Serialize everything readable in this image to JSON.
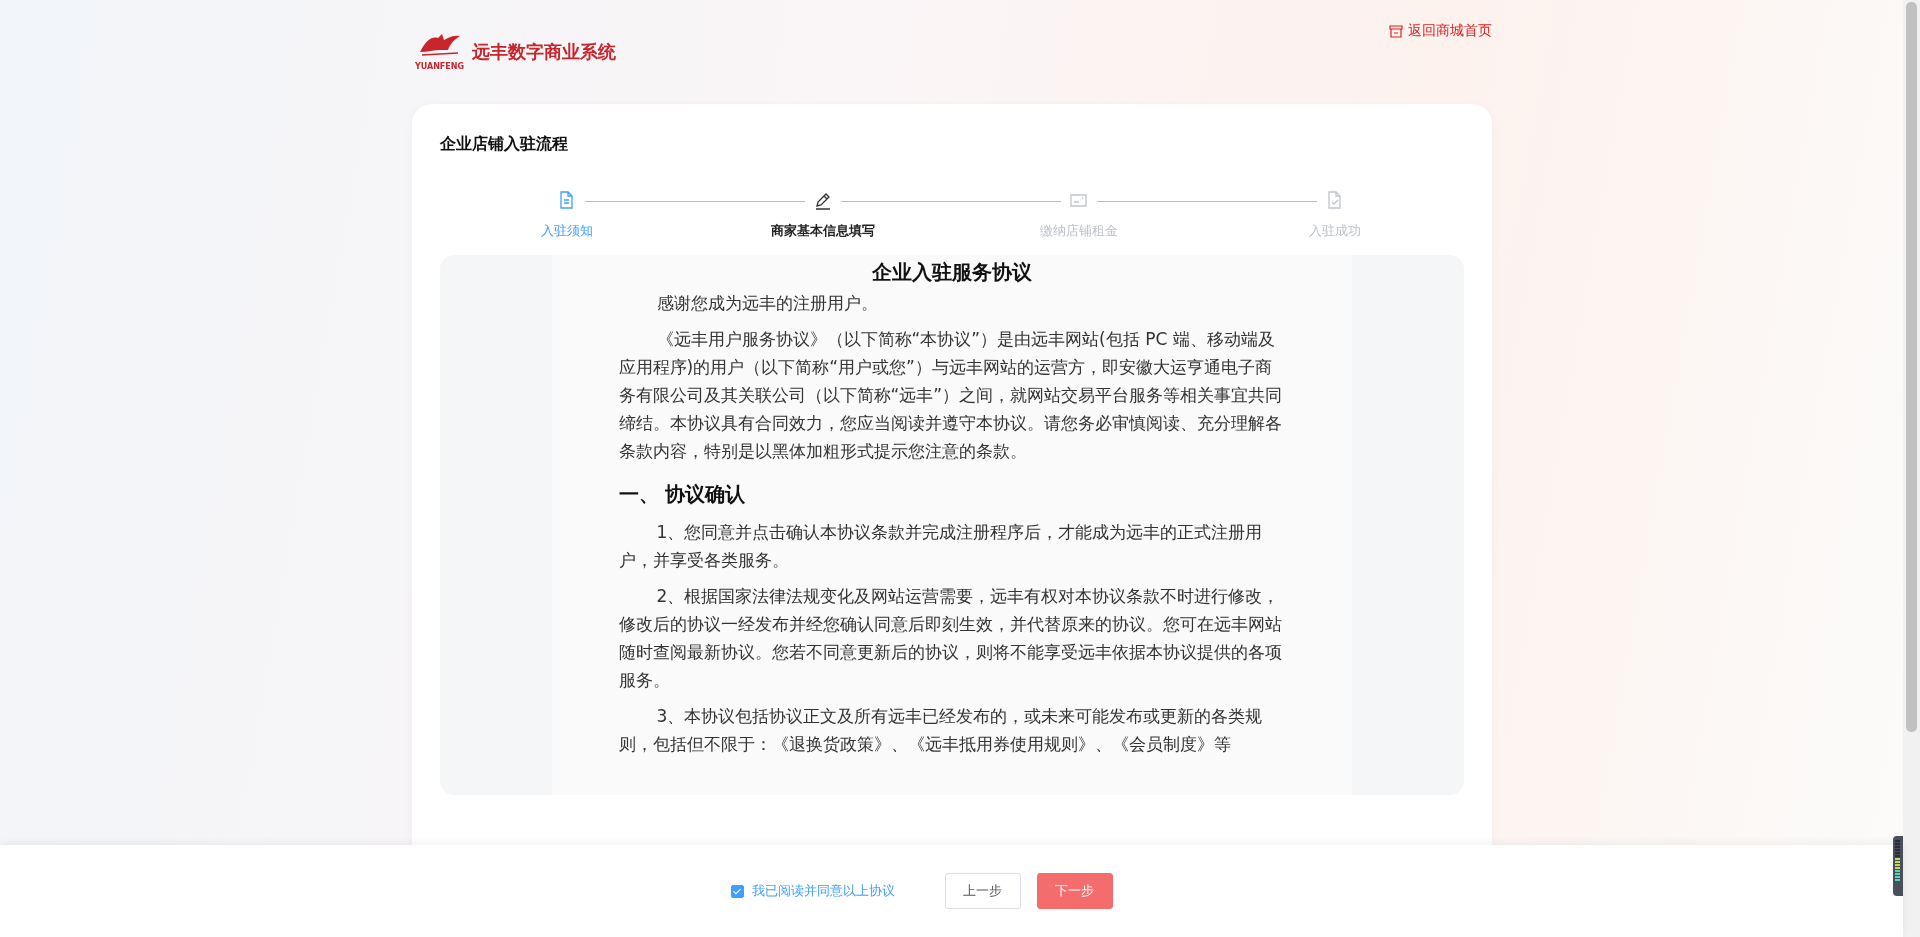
{
  "header": {
    "brand": "远丰数字商业系统",
    "logo_text": "YUANFENG",
    "home_link": "返回商城首页"
  },
  "card": {
    "title": "企业店铺入驻流程"
  },
  "steps": [
    {
      "label": "入驻须知",
      "kind": "done"
    },
    {
      "label": "商家基本信息填写",
      "kind": "current"
    },
    {
      "label": "缴纳店铺租金",
      "kind": "pending"
    },
    {
      "label": "入驻成功",
      "kind": "pending"
    }
  ],
  "agreement": {
    "title": "企业入驻服务协议",
    "blocks": [
      {
        "kind": "para",
        "text": "感谢您成为远丰的注册用户。"
      },
      {
        "kind": "para",
        "text": "《远丰用户服务协议》（以下简称“本协议”）是由远丰网站(包括 PC 端、移动端及应用程序)的用户（以下简称“用户或您”）与远丰网站的运营方，即安徽大运亨通电子商务有限公司及其关联公司（以下简称“远丰”）之间，就网站交易平台服务等相关事宜共同缔结。本协议具有合同效力，您应当阅读并遵守本协议。请您务必审慎阅读、充分理解各条款内容，特别是以黑体加粗形式提示您注意的条款。"
      },
      {
        "kind": "heading",
        "text": "一、 协议确认"
      },
      {
        "kind": "para",
        "text": "1、您同意并点击确认本协议条款并完成注册程序后，才能成为远丰的正式注册用户，并享受各类服务。"
      },
      {
        "kind": "para",
        "text": "2、根据国家法律法规变化及网站运营需要，远丰有权对本协议条款不时进行修改，修改后的协议一经发布并经您确认同意后即刻生效，并代替原来的协议。您可在远丰网站随时查阅最新协议。您若不同意更新后的协议，则将不能享受远丰依据本协议提供的各项服务。"
      },
      {
        "kind": "para",
        "text": "3、本协议包括协议正文及所有远丰已经发布的，或未来可能发布或更新的各类规则，包括但不限于：《退换货政策》、《远丰抵用券使用规则》、《会员制度》等"
      }
    ]
  },
  "footer": {
    "agree": {
      "label": "我已阅读并同意以上协议",
      "checked": true
    },
    "buttons": [
      {
        "label": "上一步",
        "kind": "secondary"
      },
      {
        "label": "下一步",
        "kind": "primary"
      }
    ]
  }
}
